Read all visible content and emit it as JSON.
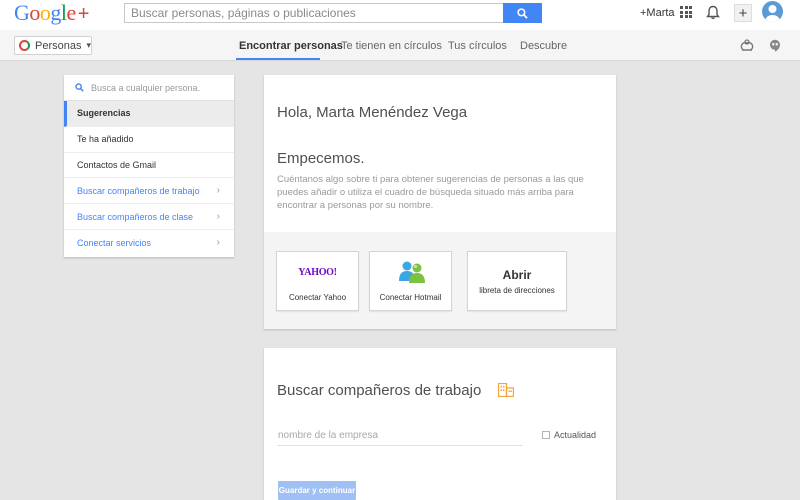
{
  "header": {
    "logo_text": "Google",
    "logo_plus": "+",
    "search_placeholder": "Buscar personas, páginas o publicaciones",
    "user_link": "+Marta"
  },
  "subnav": {
    "section_label": "Personas",
    "tabs": [
      {
        "label": "Encontrar personas",
        "active": true
      },
      {
        "label": "Te tienen en círculos",
        "active": false
      },
      {
        "label": "Tus círculos",
        "active": false
      },
      {
        "label": "Descubre",
        "active": false
      }
    ]
  },
  "sidebar": {
    "search_placeholder": "Busca a cualquier persona.",
    "items": [
      {
        "label": "Sugerencias",
        "selected": true
      },
      {
        "label": "Te ha añadido"
      },
      {
        "label": "Contactos de Gmail"
      },
      {
        "label": "Buscar compañeros de trabajo",
        "link": true
      },
      {
        "label": "Buscar compañeros de clase",
        "link": true
      },
      {
        "label": "Conectar servicios",
        "link": true
      }
    ]
  },
  "welcome": {
    "greeting": "Hola, Marta Menéndez Vega",
    "heading": "Empecemos.",
    "description": "Cuéntanos algo sobre ti para obtener sugerencias de personas a las que puedes añadir o utiliza el cuadro de búsqueda situado más arriba para encontrar a personas por su nombre."
  },
  "providers": {
    "yahoo_logo": "YAHOO!",
    "yahoo_label": "Conectar Yahoo",
    "hotmail_label": "Conectar Hotmail",
    "open_title": "Abrir",
    "open_sub": "libreta de direcciones"
  },
  "coworkers": {
    "title": "Buscar compañeros de trabajo",
    "company_placeholder": "nombre de la empresa",
    "current_label": "Actualidad",
    "save_label": "Guardar y continuar"
  },
  "colors": {
    "accent": "#4285f4",
    "building_icon": "#f4a43d",
    "yahoo": "#6b0ac9"
  }
}
